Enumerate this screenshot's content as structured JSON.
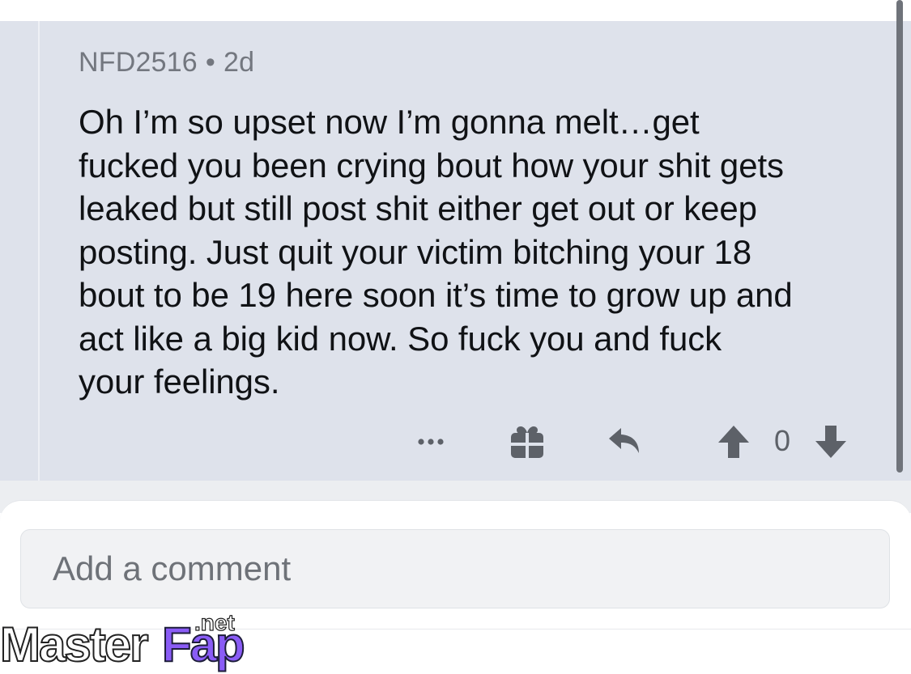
{
  "comment": {
    "author": "NFD2516",
    "separator": "•",
    "age": "2d",
    "lines": [
      "Oh I’m so upset now I’m gonna melt…get",
      "fucked you been crying bout how your shit gets",
      "leaked but still post shit either get out or keep",
      "posting. Just quit your victim bitching your 18",
      "bout to be 19 here soon it’s time to grow up and",
      "act like a big kid now. So fuck you and fuck",
      "your feelings."
    ],
    "vote_count": "0",
    "icons": {
      "more": "more-dots-icon",
      "gift": "gift-icon",
      "reply": "reply-icon",
      "upvote": "upvote-icon",
      "downvote": "downvote-icon"
    }
  },
  "composer": {
    "placeholder": "Add a comment"
  },
  "watermark": {
    "part1": "Master",
    "part2": "Fap",
    "suffix": ".net"
  },
  "colors": {
    "panel_bg": "#dee2eb",
    "text": "#101215",
    "meta": "#73777f",
    "icon": "#5d6168"
  }
}
